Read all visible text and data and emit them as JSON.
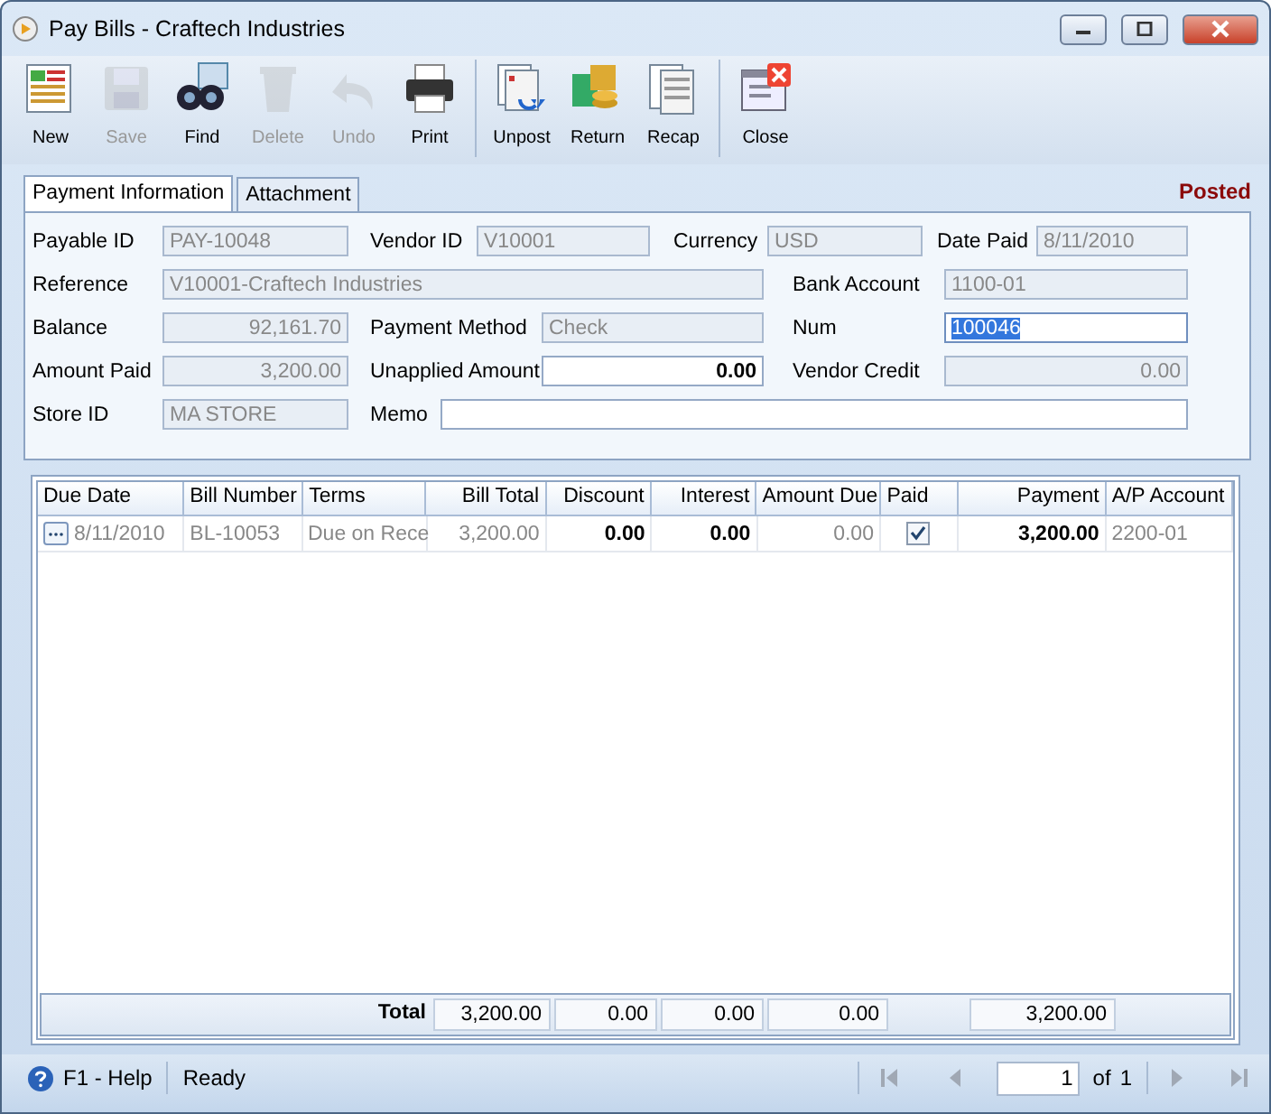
{
  "window": {
    "title": "Pay Bills - Craftech Industries"
  },
  "toolbar": [
    [
      {
        "label": "New",
        "disabled": false
      },
      {
        "label": "Save",
        "disabled": true
      },
      {
        "label": "Find",
        "disabled": false
      },
      {
        "label": "Delete",
        "disabled": true
      },
      {
        "label": "Undo",
        "disabled": true
      },
      {
        "label": "Print",
        "disabled": false
      }
    ],
    [
      {
        "label": "Unpost",
        "disabled": false
      },
      {
        "label": "Return",
        "disabled": false
      },
      {
        "label": "Recap",
        "disabled": false
      }
    ],
    [
      {
        "label": "Close",
        "disabled": false
      }
    ]
  ],
  "tabs": [
    {
      "label": "Payment Information",
      "selected": true
    },
    {
      "label": "Attachment",
      "selected": false
    }
  ],
  "status": "Posted",
  "form": [
    [
      {
        "label": "Payable ID",
        "value": "PAY-10048",
        "kind": "text",
        "disabled": true,
        "selected": false
      },
      {
        "label": "Vendor ID",
        "value": "V10001",
        "kind": "text",
        "disabled": true,
        "selected": false
      },
      {
        "label": "Currency",
        "value": "USD",
        "kind": "text",
        "disabled": true,
        "selected": false
      },
      {
        "label": "Date Paid",
        "value": "8/11/2010",
        "kind": "text",
        "disabled": true,
        "selected": false
      }
    ],
    [
      {
        "label": "Reference",
        "value": "V10001-Craftech Industries",
        "kind": "text",
        "disabled": true,
        "selected": false
      },
      {
        "label": "Bank Account",
        "value": "1100-01",
        "kind": "text",
        "disabled": true,
        "selected": false
      }
    ],
    [
      {
        "label": "Balance",
        "value": "92,161.70",
        "kind": "amount",
        "disabled": true,
        "selected": false
      },
      {
        "label": "Payment Method",
        "value": "Check",
        "kind": "text",
        "disabled": true,
        "selected": false
      },
      {
        "label": "Num",
        "value": "100046",
        "kind": "text",
        "disabled": false,
        "selected": true
      }
    ],
    [
      {
        "label": "Amount Paid",
        "value": "3,200.00",
        "kind": "amount",
        "disabled": true,
        "selected": false
      },
      {
        "label": "Unapplied Amount",
        "value": "0.00",
        "kind": "amount",
        "disabled": false,
        "selected": false
      },
      {
        "label": "Vendor Credit",
        "value": "0.00",
        "kind": "amount",
        "disabled": true,
        "selected": false
      }
    ],
    [
      {
        "label": "Store ID",
        "value": "MA STORE",
        "kind": "text",
        "disabled": true,
        "selected": false
      },
      {
        "label": "Memo",
        "kind": "text",
        "disabled": false,
        "selected": false
      }
    ]
  ],
  "table": {
    "columns": [
      "Due Date",
      "Bill Number",
      "Terms",
      "Bill Total",
      "Discount",
      "Interest",
      "Amount Due",
      "Paid",
      "Payment",
      "A/P Account"
    ],
    "rows": [
      {
        "due_date": "8/11/2010",
        "bill_number": "BL-10053",
        "terms": "Due on Rece",
        "bill_total": "3,200.00",
        "discount": "0.00",
        "interest": "0.00",
        "amount_due": "0.00",
        "paid": true,
        "payment": "3,200.00",
        "ap_account": "2200-01"
      }
    ],
    "totals": {
      "label": "Total",
      "bill_total": "3,200.00",
      "discount": "0.00",
      "interest": "0.00",
      "amount_due": "0.00",
      "payment": "3,200.00"
    }
  },
  "status_bar": {
    "help": "F1 - Help",
    "message": "Ready",
    "page": "1",
    "of": "of",
    "pages": "1"
  }
}
